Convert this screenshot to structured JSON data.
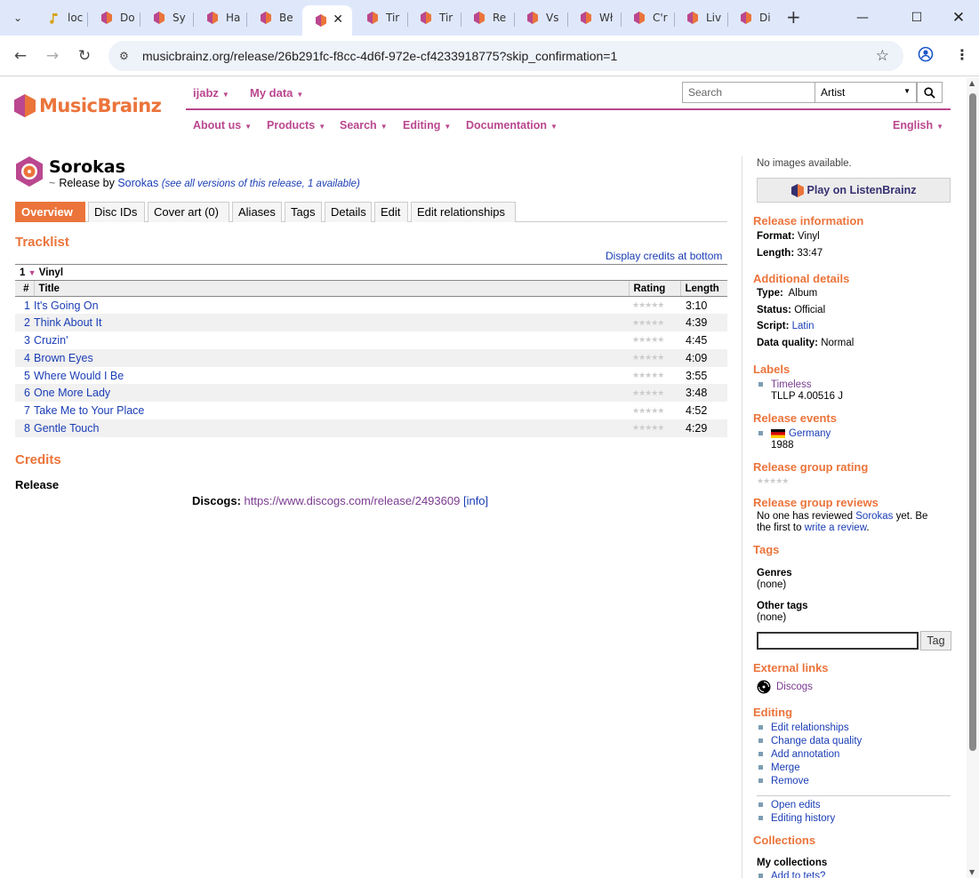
{
  "browser": {
    "tabs": [
      {
        "label": "loc",
        "active": false
      },
      {
        "label": "Do",
        "active": false
      },
      {
        "label": "Sy",
        "active": false
      },
      {
        "label": "Ha",
        "active": false
      },
      {
        "label": "Be",
        "active": false
      },
      {
        "label": "",
        "active": true
      },
      {
        "label": "Tir",
        "active": false
      },
      {
        "label": "Tir",
        "active": false
      },
      {
        "label": "Re",
        "active": false
      },
      {
        "label": "Vs",
        "active": false
      },
      {
        "label": "Wł",
        "active": false
      },
      {
        "label": "C'r",
        "active": false
      },
      {
        "label": "Liv",
        "active": false
      },
      {
        "label": "Di",
        "active": false
      }
    ],
    "url": "musicbrainz.org/release/26b291fc-f8cc-4d6f-972e-cf4233918775?skip_confirmation=1"
  },
  "header": {
    "logo_text": "MusicBrainz",
    "user_menu": "ijabz",
    "my_data_menu": "My data",
    "search_placeholder": "Search",
    "search_type": "Artist",
    "nav": [
      "About us",
      "Products",
      "Search",
      "Editing",
      "Documentation"
    ],
    "language": "English"
  },
  "release": {
    "title": "Sorokas",
    "release_by": "Release by",
    "artist": "Sorokas",
    "see_all": "(see all versions of this release, 1 available)",
    "tabs": [
      "Overview",
      "Disc IDs",
      "Cover art (0)",
      "Aliases",
      "Tags",
      "Details",
      "Edit",
      "Edit relationships"
    ]
  },
  "tracklist": {
    "heading": "Tracklist",
    "display_credits": "Display credits at bottom",
    "medium_number": "1",
    "medium_format": "Vinyl",
    "columns": {
      "num": "#",
      "title": "Title",
      "rating": "Rating",
      "length": "Length"
    },
    "tracks": [
      {
        "num": "1",
        "title": "It's Going On",
        "length": "3:10"
      },
      {
        "num": "2",
        "title": "Think About It",
        "length": "4:39"
      },
      {
        "num": "3",
        "title": "Cruzin'",
        "length": "4:45"
      },
      {
        "num": "4",
        "title": "Brown Eyes",
        "length": "4:09"
      },
      {
        "num": "5",
        "title": "Where Would I Be",
        "length": "3:55"
      },
      {
        "num": "6",
        "title": "One More Lady",
        "length": "3:48"
      },
      {
        "num": "7",
        "title": "Take Me to Your Place",
        "length": "4:52"
      },
      {
        "num": "8",
        "title": "Gentle Touch",
        "length": "4:29"
      }
    ]
  },
  "credits": {
    "heading": "Credits",
    "release_label": "Release",
    "discogs_label": "Discogs:",
    "discogs_url": "https://www.discogs.com/release/2493609",
    "info_link": "[info]"
  },
  "sidebar": {
    "no_images": "No images available.",
    "listenbrainz": "Play on ListenBrainz",
    "release_info_heading": "Release information",
    "format_label": "Format:",
    "format_value": "Vinyl",
    "length_label": "Length:",
    "length_value": "33:47",
    "additional_heading": "Additional details",
    "type_label": "Type:",
    "type_value": "Album",
    "status_label": "Status:",
    "status_value": "Official",
    "script_label": "Script:",
    "script_value": "Latin",
    "quality_label": "Data quality:",
    "quality_value": "Normal",
    "labels_heading": "Labels",
    "label_name": "Timeless",
    "label_catno": "TLLP 4.00516 J",
    "events_heading": "Release events",
    "event_country": "Germany",
    "event_year": "1988",
    "rating_heading": "Release group rating",
    "reviews_heading": "Release group reviews",
    "reviews_line1_a": "No one has reviewed",
    "reviews_artist": "Sorokas",
    "reviews_line1_b": "yet. Be",
    "reviews_line2_a": "the first to",
    "reviews_write": "write a review",
    "reviews_period": ".",
    "tags_heading": "Tags",
    "genres_label": "Genres",
    "genres_value": "(none)",
    "other_tags_label": "Other tags",
    "other_tags_value": "(none)",
    "tag_button": "Tag",
    "external_heading": "External links",
    "external_discogs": "Discogs",
    "editing_heading": "Editing",
    "editing_links": [
      "Edit relationships",
      "Change data quality",
      "Add annotation",
      "Merge",
      "Remove"
    ],
    "edit_history_links": [
      "Open edits",
      "Editing history"
    ],
    "collections_heading": "Collections",
    "my_collections": "My collections",
    "add_to": "Add to tets?"
  },
  "colors": {
    "brand_orange": "#eb743b",
    "brand_purple": "#ba478f",
    "link_blue": "#1a3db5"
  }
}
